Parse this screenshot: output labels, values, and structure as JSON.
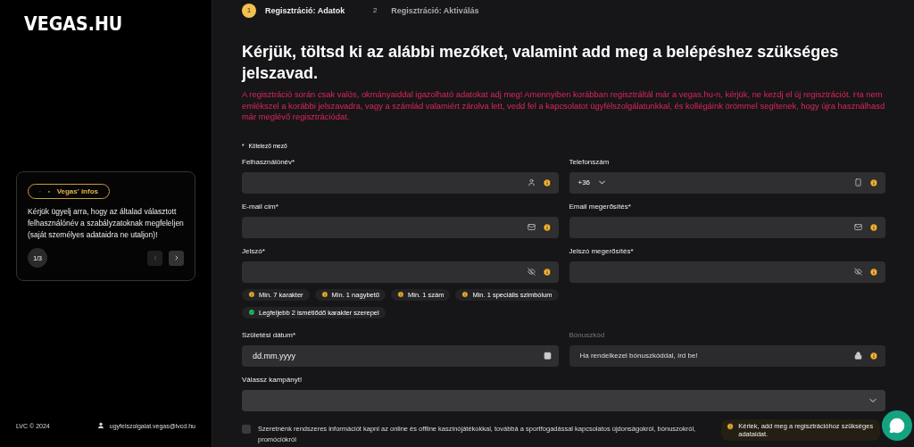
{
  "sidebar": {
    "logo": "VEGAS.HU",
    "info_card": {
      "badge": "Vegas' infos",
      "text": "Kérjük ügyelj arra, hogy az általad választott felhasználónév a szabályzatoknak megfeleljen (saját személyes adataidra ne utaljon)!",
      "counter": "1/3",
      "prev_disabled": true
    },
    "footer": {
      "copyright": "LVC © 2024",
      "email": "ugyfelszolgalat.vegas@lvcd.hu"
    }
  },
  "steps": [
    {
      "number": "1",
      "label": "Regisztráció: Adatok",
      "selected": true
    },
    {
      "number": "2",
      "label": "Regisztráció: Aktiválás",
      "selected": false
    }
  ],
  "heading": "Kérjük, töltsd ki az alábbi mezőket, valamint add meg a belépéshez szükséges jelszavad.",
  "notice": "A regisztráció során csak valós, okmányaiddal igazolható adatokat adj meg! Amennyiben korábban regisztráltál már a vegas.hu-n, kérjük, ne kezdj el új regisztrációt. Ha nem emlékszel a korábbi jelszavadra, vagy a számlád valamiért zárolva lett, vedd fel a kapcsolatot ügyfélszolgálatunkkal, és kollégáink örömmel segítenek, hogy újra használhasd már meglévő regisztrációdat.",
  "required_note": {
    "mark": "*",
    "text": "Kötelező mező"
  },
  "form_rows": [
    [
      {
        "label": "Felhasználónév*",
        "info": true,
        "disabled": false
      },
      {
        "label": "Telefonszám",
        "prefix": "+36",
        "info": true,
        "disabled": false
      }
    ],
    [
      {
        "label": "E-mail cím*",
        "info": true,
        "disabled": false
      },
      {
        "label": "Email megerősítés*",
        "info": true,
        "disabled": false
      }
    ],
    [
      {
        "label": "Jelszó*",
        "info": true,
        "disabled": false
      },
      {
        "label": "Jelszó megerősítés*",
        "info": true,
        "disabled": false
      }
    ]
  ],
  "password_rules": [
    [
      {
        "text": "Min. 7 karakter",
        "met": false
      },
      {
        "text": "Min. 1 nagybetű",
        "met": false
      },
      {
        "text": "Min. 1 szám",
        "met": false
      },
      {
        "text": "Min. 1 speciális szimbólum",
        "met": false
      }
    ],
    [
      {
        "text": "Legfeljebb 2 ismétlődő karakter szerepel",
        "met": true
      }
    ]
  ],
  "form_rows_2": [
    [
      {
        "label": "Születési dátum*",
        "placeholder": "dd.mm.yyyy",
        "info": false,
        "disabled": false
      },
      {
        "label": "Bónuszkód",
        "placeholder": "Ha rendelkezel bónuszkóddal, írd be!",
        "info": true,
        "disabled": true
      }
    ]
  ],
  "campaign": {
    "label": "Válassz kampányt!"
  },
  "newsletter": {
    "text": "Szeretnénk rendszeres információt kapni az online és offline kaszinójátékokkal, továbbá a sportfogadással kapcsolatos újdonságokról, bónuszokról, promóciókról",
    "checked": false
  },
  "toast": {
    "text": "Kérlek, add meg a regisztrációhoz szükséges adataidat."
  }
}
